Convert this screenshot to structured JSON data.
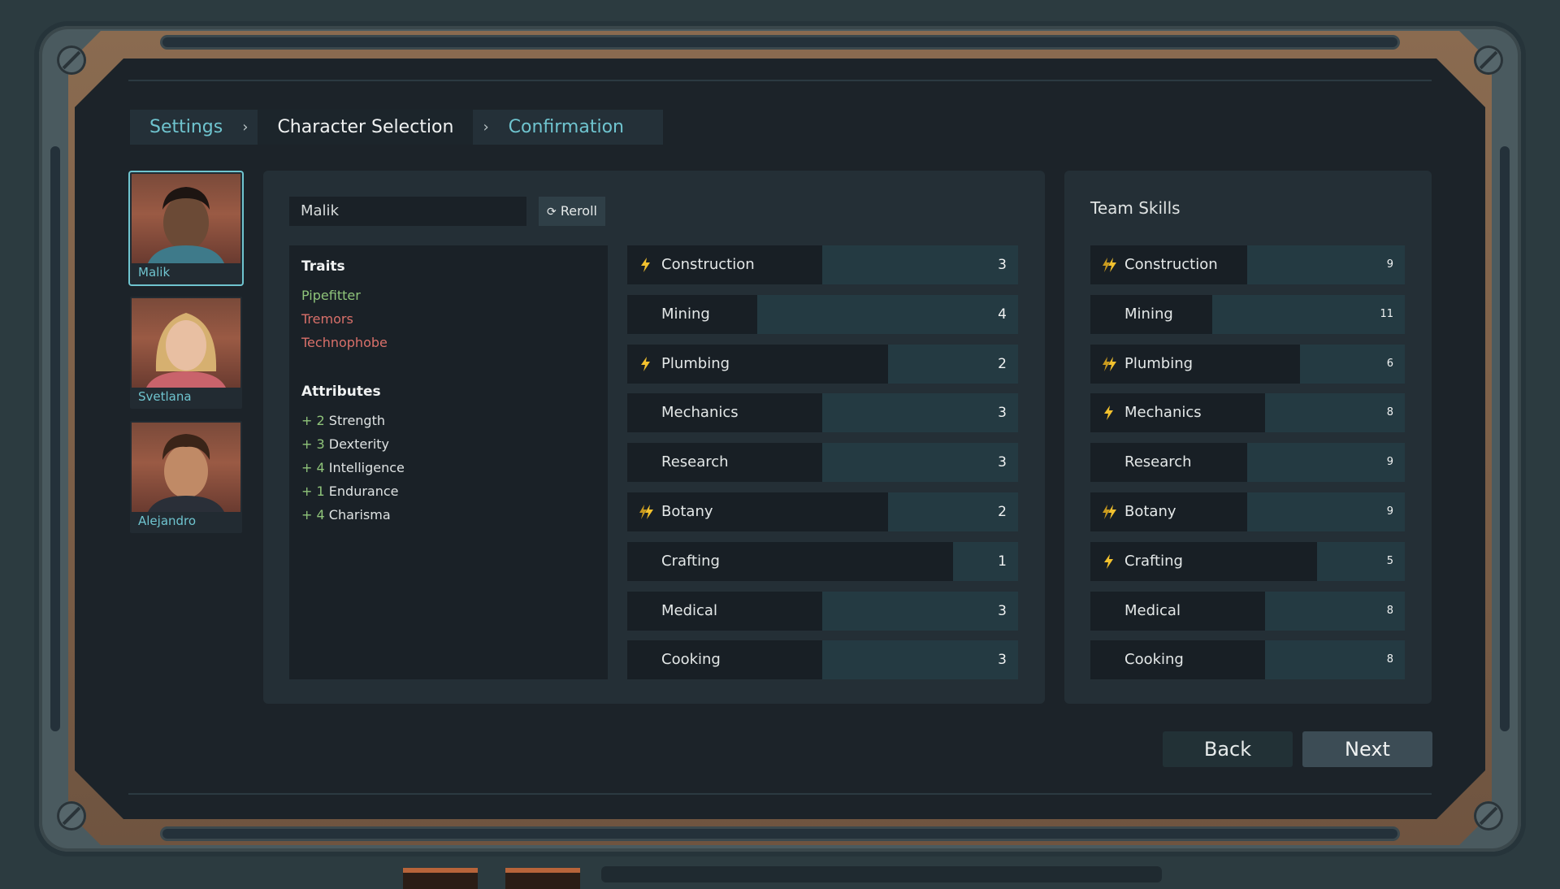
{
  "breadcrumb": {
    "items": [
      "Settings",
      "Character Selection",
      "Confirmation"
    ],
    "separator": "›"
  },
  "characters": [
    {
      "name": "Malik",
      "selected": true
    },
    {
      "name": "Svetlana",
      "selected": false
    },
    {
      "name": "Alejandro",
      "selected": false
    }
  ],
  "character": {
    "name": "Malik",
    "reroll_label": "Reroll",
    "reroll_icon": "refresh-icon",
    "traits_title": "Traits",
    "traits": [
      {
        "label": "Pipefitter",
        "color": "#8fc47a"
      },
      {
        "label": "Tremors",
        "color": "#d9706a"
      },
      {
        "label": "Technophobe",
        "color": "#d9706a"
      }
    ],
    "attributes_title": "Attributes",
    "attributes": [
      {
        "plus": "+",
        "value": "2",
        "label": "Strength"
      },
      {
        "plus": "+",
        "value": "3",
        "label": "Dexterity"
      },
      {
        "plus": "+",
        "value": "4",
        "label": "Intelligence"
      },
      {
        "plus": "+",
        "value": "1",
        "label": "Endurance"
      },
      {
        "plus": "+",
        "value": "4",
        "label": "Charisma"
      }
    ]
  },
  "skills": [
    {
      "label": "Construction",
      "value": "3",
      "icon": "bolt-icon"
    },
    {
      "label": "Mining",
      "value": "4",
      "icon": ""
    },
    {
      "label": "Plumbing",
      "value": "2",
      "icon": "bolt-icon"
    },
    {
      "label": "Mechanics",
      "value": "3",
      "icon": ""
    },
    {
      "label": "Research",
      "value": "3",
      "icon": ""
    },
    {
      "label": "Botany",
      "value": "2",
      "icon": "double-bolt-icon"
    },
    {
      "label": "Crafting",
      "value": "1",
      "icon": ""
    },
    {
      "label": "Medical",
      "value": "3",
      "icon": ""
    },
    {
      "label": "Cooking",
      "value": "3",
      "icon": ""
    }
  ],
  "team": {
    "title": "Team Skills",
    "skills": [
      {
        "label": "Construction",
        "value": "9",
        "icon": "double-bolt-icon"
      },
      {
        "label": "Mining",
        "value": "11",
        "icon": ""
      },
      {
        "label": "Plumbing",
        "value": "6",
        "icon": "double-bolt-icon"
      },
      {
        "label": "Mechanics",
        "value": "8",
        "icon": "bolt-icon"
      },
      {
        "label": "Research",
        "value": "9",
        "icon": ""
      },
      {
        "label": "Botany",
        "value": "9",
        "icon": "double-bolt-icon"
      },
      {
        "label": "Crafting",
        "value": "5",
        "icon": "bolt-icon"
      },
      {
        "label": "Medical",
        "value": "8",
        "icon": ""
      },
      {
        "label": "Cooking",
        "value": "8",
        "icon": ""
      }
    ]
  },
  "buttons": {
    "back": "Back",
    "next": "Next"
  },
  "colors": {
    "accent": "#6fc4cf",
    "bolt": "#f2c12e",
    "positive": "#8fc47a",
    "negative": "#d9706a"
  }
}
